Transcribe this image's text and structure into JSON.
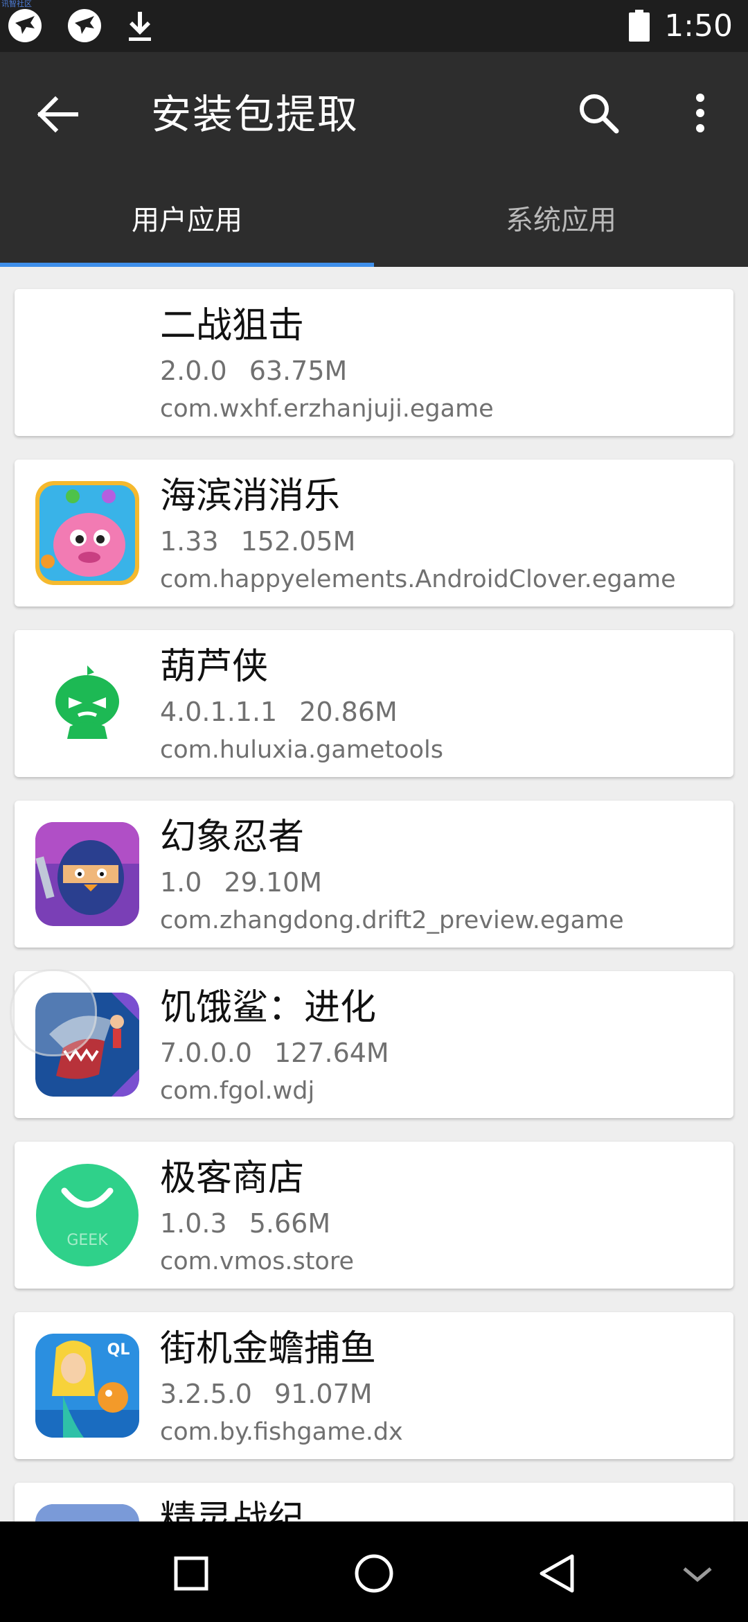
{
  "status_bar": {
    "watermark": "讯智社区",
    "time": "1:50",
    "icons": [
      "bird-notification-icon",
      "bird-notification-icon",
      "download-icon",
      "battery-icon"
    ]
  },
  "app_bar": {
    "title": "安装包提取",
    "icons": [
      "back-arrow-icon",
      "search-icon",
      "more-vert-icon"
    ]
  },
  "tabs": [
    {
      "label": "用户应用",
      "selected": true
    },
    {
      "label": "系统应用",
      "selected": false
    }
  ],
  "colors": {
    "app_bar": "#2d2d2d",
    "tab_indicator": "#3f8fea",
    "background": "#eeeeee"
  },
  "apps": [
    {
      "name": "二战狙击",
      "version": "2.0.0",
      "size": "63.75M",
      "package": "com.wxhf.erzhanjuji.egame",
      "icon": "blank-icon"
    },
    {
      "name": "海滨消消乐",
      "version": "1.33",
      "size": "152.05M",
      "package": "com.happyelements.AndroidClover.egame",
      "icon": "pink-creature-icon"
    },
    {
      "name": "葫芦侠",
      "version": "4.0.1.1.1",
      "size": "20.86M",
      "package": "com.huluxia.gametools",
      "icon": "green-gourd-icon"
    },
    {
      "name": "幻象忍者",
      "version": "1.0",
      "size": "29.10M",
      "package": "com.zhangdong.drift2_preview.egame",
      "icon": "ninja-icon"
    },
    {
      "name": "饥饿鲨：进化",
      "version": "7.0.0.0",
      "size": "127.64M",
      "package": "com.fgol.wdj",
      "icon": "shark-icon"
    },
    {
      "name": "极客商店",
      "version": "1.0.3",
      "size": "5.66M",
      "package": "com.vmos.store",
      "icon": "geek-store-icon",
      "icon_text": "GEEK"
    },
    {
      "name": "街机金蟾捕鱼",
      "version": "3.2.5.0",
      "size": "91.07M",
      "package": "com.by.fishgame.dx",
      "icon": "mermaid-fish-icon",
      "icon_text": "QL"
    },
    {
      "name": "精灵战纪",
      "version": "",
      "size": "",
      "package": "",
      "icon": "partial-icon"
    }
  ],
  "nav_bar": {
    "icons": [
      "recents-square-icon",
      "home-circle-icon",
      "back-triangle-icon",
      "hide-chevron-icon"
    ]
  }
}
